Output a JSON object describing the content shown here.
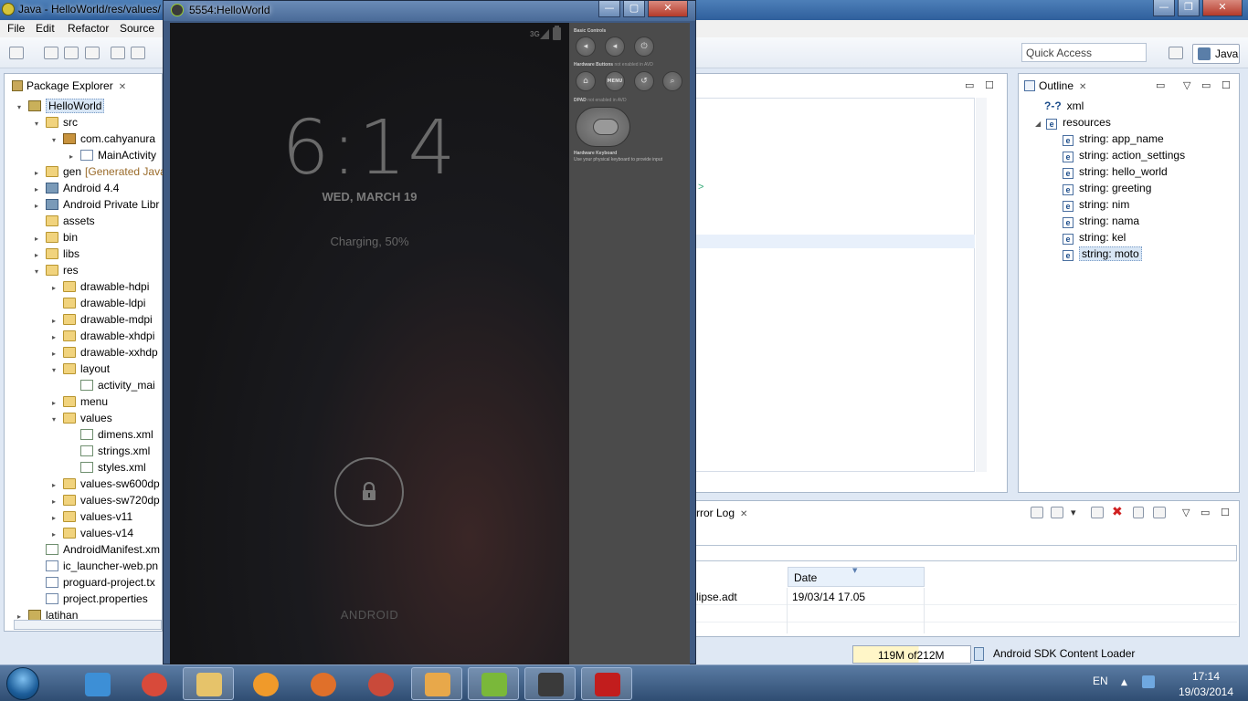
{
  "eclipse": {
    "title": "Java - HelloWorld/res/values/",
    "menu": [
      "File",
      "Edit",
      "Refactor",
      "Source"
    ],
    "quick_access_placeholder": "Quick Access",
    "perspective": "Java"
  },
  "package_explorer": {
    "tab_label": "Package Explorer",
    "tree": [
      {
        "label": "HelloWorld",
        "depth": 0,
        "twisty": "▾",
        "icon": "project-icon",
        "highlight": true
      },
      {
        "label": "src",
        "depth": 1,
        "twisty": "▾",
        "icon": "folder-icon"
      },
      {
        "label": "com.cahyanura",
        "depth": 2,
        "twisty": "▾",
        "icon": "package-icon"
      },
      {
        "label": "MainActivity",
        "depth": 3,
        "twisty": "▸",
        "icon": "java-file-icon"
      },
      {
        "label": "gen",
        "suffix": "[Generated Java",
        "depth": 1,
        "twisty": "▸",
        "icon": "folder-icon"
      },
      {
        "label": "Android 4.4",
        "depth": 1,
        "twisty": "▸",
        "icon": "library-icon"
      },
      {
        "label": "Android Private Libr",
        "depth": 1,
        "twisty": "▸",
        "icon": "library-icon"
      },
      {
        "label": "assets",
        "depth": 1,
        "twisty": "",
        "icon": "folder-icon"
      },
      {
        "label": "bin",
        "depth": 1,
        "twisty": "▸",
        "icon": "folder-icon"
      },
      {
        "label": "libs",
        "depth": 1,
        "twisty": "▸",
        "icon": "folder-icon"
      },
      {
        "label": "res",
        "depth": 1,
        "twisty": "▾",
        "icon": "folder-icon"
      },
      {
        "label": "drawable-hdpi",
        "depth": 2,
        "twisty": "▸",
        "icon": "folder-icon"
      },
      {
        "label": "drawable-ldpi",
        "depth": 2,
        "twisty": "",
        "icon": "folder-icon"
      },
      {
        "label": "drawable-mdpi",
        "depth": 2,
        "twisty": "▸",
        "icon": "folder-icon"
      },
      {
        "label": "drawable-xhdpi",
        "depth": 2,
        "twisty": "▸",
        "icon": "folder-icon"
      },
      {
        "label": "drawable-xxhdp",
        "depth": 2,
        "twisty": "▸",
        "icon": "folder-icon"
      },
      {
        "label": "layout",
        "depth": 2,
        "twisty": "▾",
        "icon": "folder-icon"
      },
      {
        "label": "activity_mai",
        "depth": 3,
        "twisty": "",
        "icon": "xml-file-icon"
      },
      {
        "label": "menu",
        "depth": 2,
        "twisty": "▸",
        "icon": "folder-icon"
      },
      {
        "label": "values",
        "depth": 2,
        "twisty": "▾",
        "icon": "folder-icon"
      },
      {
        "label": "dimens.xml",
        "depth": 3,
        "twisty": "",
        "icon": "xml-file-icon"
      },
      {
        "label": "strings.xml",
        "depth": 3,
        "twisty": "",
        "icon": "xml-file-icon"
      },
      {
        "label": "styles.xml",
        "depth": 3,
        "twisty": "",
        "icon": "xml-file-icon"
      },
      {
        "label": "values-sw600dp",
        "depth": 2,
        "twisty": "▸",
        "icon": "folder-icon"
      },
      {
        "label": "values-sw720dp",
        "depth": 2,
        "twisty": "▸",
        "icon": "folder-icon"
      },
      {
        "label": "values-v11",
        "depth": 2,
        "twisty": "▸",
        "icon": "folder-icon"
      },
      {
        "label": "values-v14",
        "depth": 2,
        "twisty": "▸",
        "icon": "folder-icon"
      },
      {
        "label": "AndroidManifest.xm",
        "depth": 1,
        "twisty": "",
        "icon": "xml-file-icon"
      },
      {
        "label": "ic_launcher-web.pn",
        "depth": 1,
        "twisty": "",
        "icon": "image-file-icon"
      },
      {
        "label": "proguard-project.tx",
        "depth": 1,
        "twisty": "",
        "icon": "text-file-icon"
      },
      {
        "label": "project.properties",
        "depth": 1,
        "twisty": "",
        "icon": "text-file-icon"
      },
      {
        "label": "latihan",
        "depth": 0,
        "twisty": "▸",
        "icon": "project-icon"
      }
    ]
  },
  "outline": {
    "tab_label": "Outline",
    "xml_node": "xml",
    "resources_node": "resources",
    "strings": [
      "string: app_name",
      "string: action_settings",
      "string: hello_world",
      "string: greeting",
      "string: nim",
      "string: nama",
      "string: kel",
      "string: moto"
    ]
  },
  "error_log": {
    "tab_label": "rror Log",
    "date_header": "Date",
    "row_source": "lipse.adt",
    "row_date": "19/03/14 17.05"
  },
  "status": {
    "heap_used": "119M",
    "heap_of": "of",
    "heap_total": "212M",
    "heap_fraction": 0.56,
    "job": "Android SDK Content Loader"
  },
  "emulator": {
    "title": "5554:HelloWorld",
    "network": "3G",
    "clock": "6:14",
    "date": "WED, MARCH 19",
    "charging": "Charging, 50%",
    "footer": "ANDROID",
    "controls": {
      "basic": "Basic Controls",
      "hardware": "Hardware Buttons",
      "hardware_note": "not enabled in AVD",
      "dpad": "DPAD",
      "dpad_note": "not enabled in AVD",
      "keyboard": "Hardware Keyboard",
      "keyboard_note": "Use your physical keyboard to provide input",
      "menu_label": "MENU"
    }
  },
  "taskbar": {
    "language": "EN",
    "time": "17:14",
    "date": "19/03/2014",
    "apps": [
      "internet-explorer-icon",
      "chrome-icon",
      "file-explorer-icon",
      "vlc-icon",
      "firefox-icon",
      "chrome-alt-icon",
      "media-player-icon",
      "brackets-icon",
      "android-emulator-icon",
      "acrobat-icon"
    ]
  }
}
